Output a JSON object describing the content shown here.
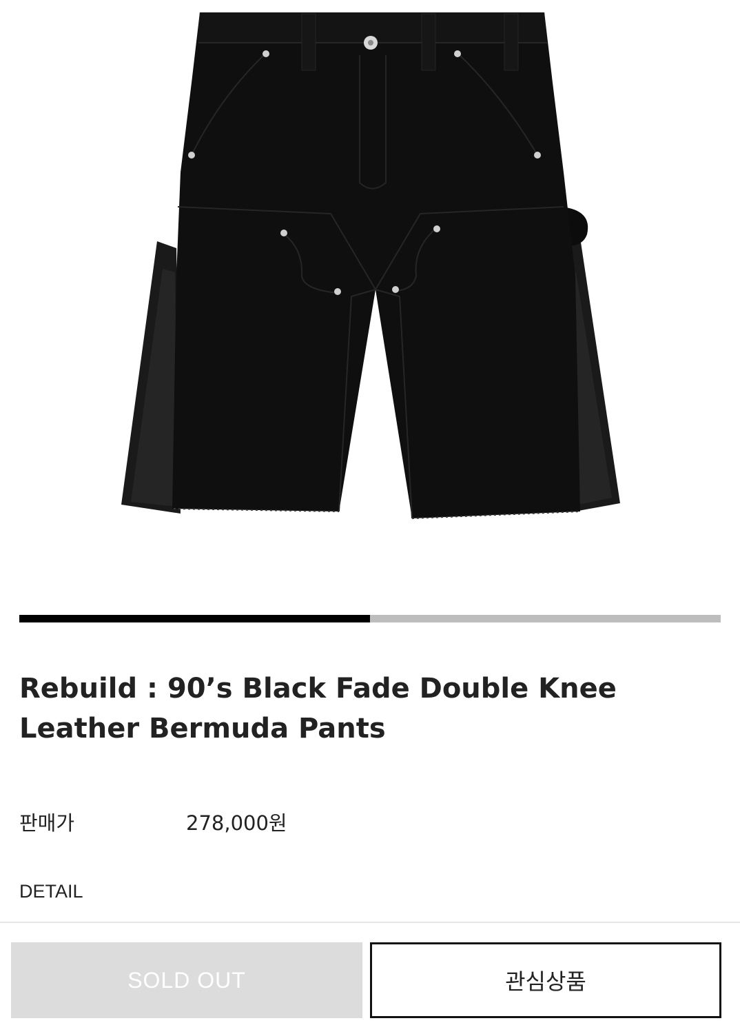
{
  "product": {
    "image_alt": "black double knee bermuda shorts with leather side panels",
    "title": "Rebuild : 90’s Black Fade Double Knee Leather Bermuda Pants",
    "price_label": "판매가",
    "price_value": "278,000원",
    "detail_label": "DETAIL"
  },
  "gallery": {
    "progress": 0.5
  },
  "actions": {
    "soldout_label": "SOLD OUT",
    "wishlist_label": "관심상품"
  },
  "colors": {
    "progress_fill": "#000000",
    "progress_track": "#bdbdbd",
    "soldout_bg": "#dcdcdc"
  }
}
